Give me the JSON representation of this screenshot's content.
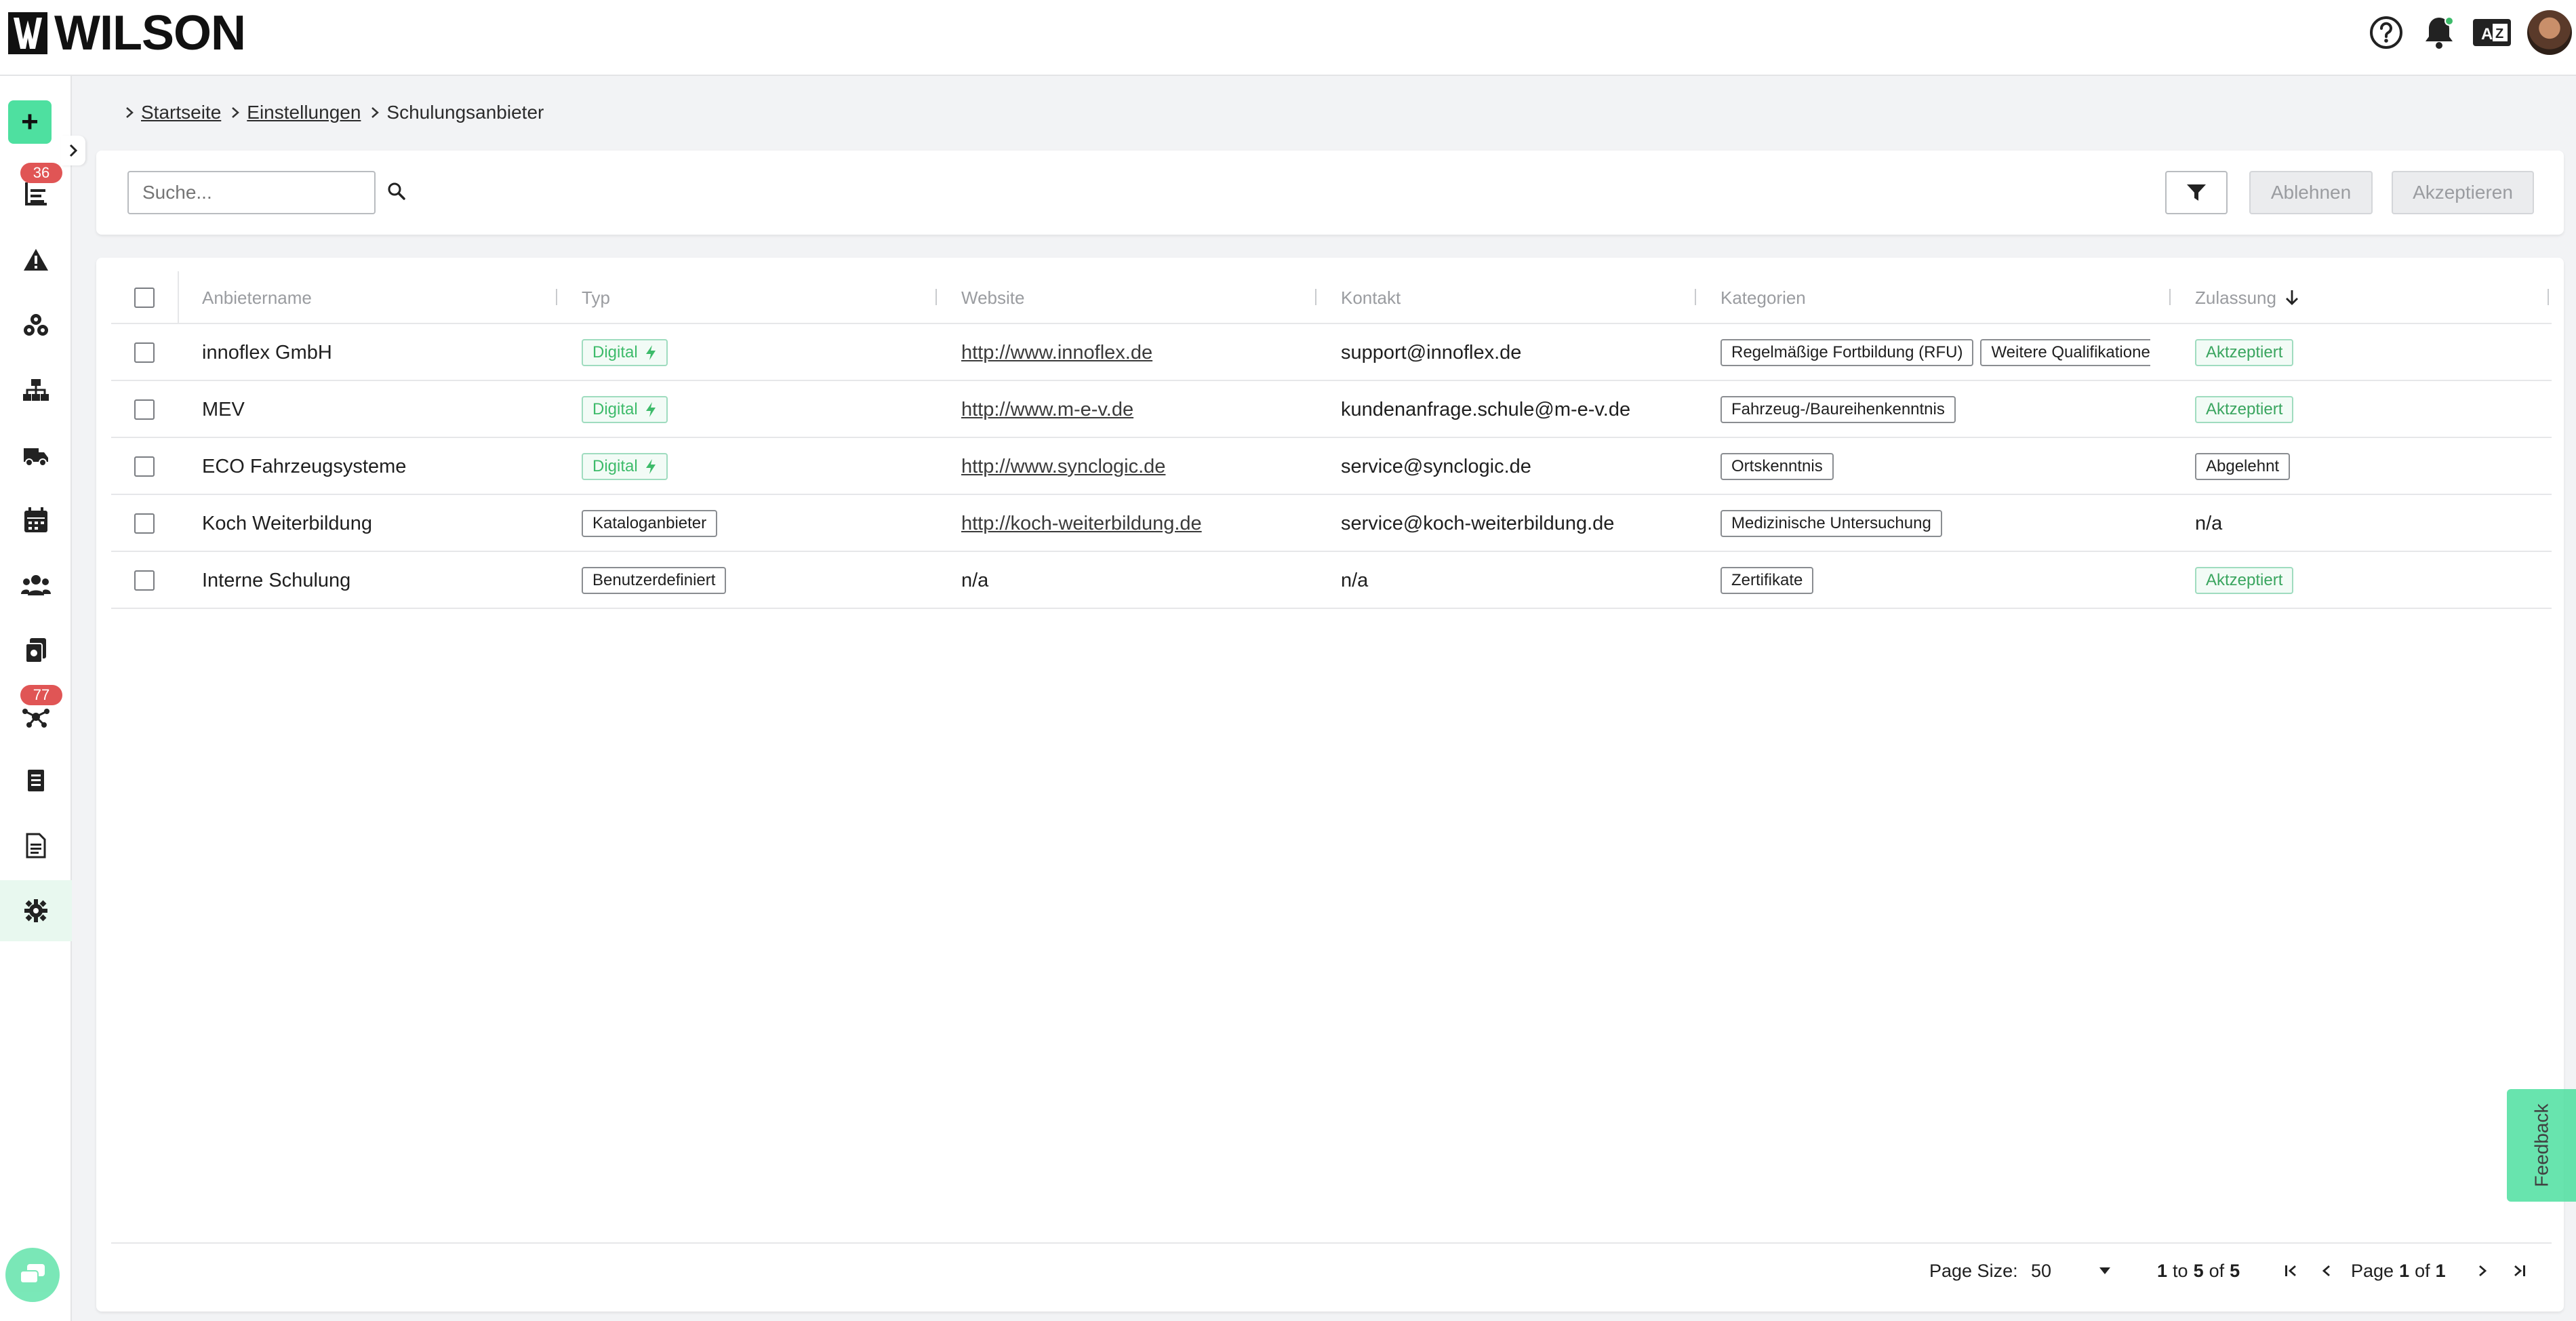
{
  "app": {
    "brand": "WILSON"
  },
  "header": {
    "icons": [
      "help-icon",
      "bell-icon",
      "language-icon",
      "avatar"
    ]
  },
  "sidebar": {
    "add_label": "+",
    "items": [
      {
        "icon": "report-icon",
        "badge": "36"
      },
      {
        "icon": "warning-icon",
        "badge": ""
      },
      {
        "icon": "components-icon",
        "badge": ""
      },
      {
        "icon": "network-icon",
        "badge": ""
      },
      {
        "icon": "vehicle-icon",
        "badge": ""
      },
      {
        "icon": "calendar-icon",
        "badge": ""
      },
      {
        "icon": "people-icon",
        "badge": ""
      },
      {
        "icon": "documents-icon",
        "badge": ""
      },
      {
        "icon": "connections-icon",
        "badge": "77"
      },
      {
        "icon": "list-icon",
        "badge": ""
      },
      {
        "icon": "file-icon",
        "badge": ""
      },
      {
        "icon": "gear-icon",
        "badge": ""
      }
    ]
  },
  "breadcrumb": {
    "home": "Startseite",
    "settings": "Einstellungen",
    "current": "Schulungsanbieter"
  },
  "toolbar": {
    "search_placeholder": "Suche...",
    "reject_label": "Ablehnen",
    "accept_label": "Akzeptieren"
  },
  "table": {
    "columns": [
      "Anbietername",
      "Typ",
      "Website",
      "Kontakt",
      "Kategorien",
      "Zulassung"
    ],
    "rows": [
      {
        "name": "innoflex GmbH",
        "type": "Digital",
        "type_digital": true,
        "website": "http://www.innoflex.de",
        "contact": "support@innoflex.de",
        "categories": [
          "Regelmäßige Fortbildung (RFU)",
          "Weitere Qualifikatione"
        ],
        "status": "Aktzeptiert",
        "status_kind": "accepted"
      },
      {
        "name": "MEV",
        "type": "Digital",
        "type_digital": true,
        "website": "http://www.m-e-v.de",
        "contact": "kundenanfrage.schule@m-e-v.de",
        "categories": [
          "Fahrzeug-/Baureihenkenntnis"
        ],
        "status": "Aktzeptiert",
        "status_kind": "accepted"
      },
      {
        "name": "ECO Fahrzeugsysteme",
        "type": "Digital",
        "type_digital": true,
        "website": "http://www.synclogic.de",
        "contact": "service@synclogic.de",
        "categories": [
          "Ortskenntnis"
        ],
        "status": "Abgelehnt",
        "status_kind": "rejected"
      },
      {
        "name": "Koch Weiterbildung",
        "type": "Kataloganbieter",
        "type_digital": false,
        "website": "http://koch-weiterbildung.de",
        "contact": "service@koch-weiterbildung.de",
        "categories": [
          "Medizinische Untersuchung"
        ],
        "status": "n/a",
        "status_kind": "none"
      },
      {
        "name": "Interne Schulung",
        "type": "Benutzerdefiniert",
        "type_digital": false,
        "website": "n/a",
        "contact": "n/a",
        "categories": [
          "Zertifikate"
        ],
        "status": "Aktzeptiert",
        "status_kind": "accepted"
      }
    ]
  },
  "pagination": {
    "page_size_label": "Page Size:",
    "page_size": "50",
    "range_from": "1",
    "range_to": "5",
    "total": "5",
    "to_word": "to",
    "of_word": "of",
    "page_word": "Page",
    "page": "1",
    "pages": "1"
  },
  "feedback_label": "Feedback",
  "colors": {
    "accent": "#4ee0a0",
    "badge": "#e05555",
    "status_green": "#3aa55f"
  }
}
